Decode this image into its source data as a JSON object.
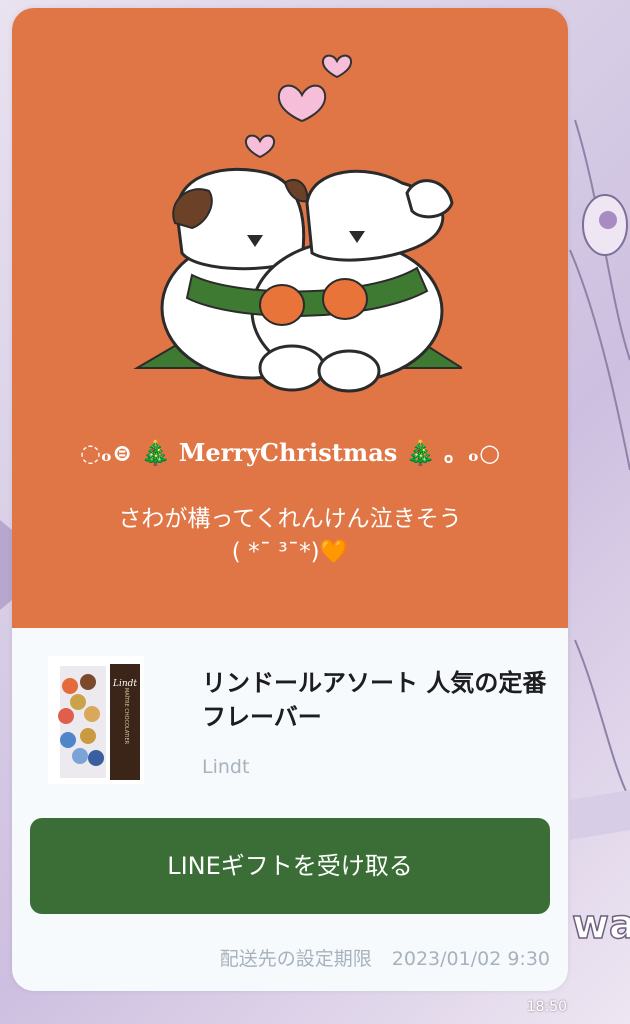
{
  "greeting": {
    "left_deco": "◌ₒ⊜",
    "left_tree": "🎄",
    "text": "MerryChristmas",
    "right_tree": "🎄",
    "right_deco": "。ₒ○"
  },
  "message": {
    "line1": "さわが構ってくれんけん泣きそう",
    "line2": "( *¯ ³¯*)",
    "heart": "🧡"
  },
  "product": {
    "title": "リンドールアソート 人気の定番フレーバー",
    "brand": "Lindt",
    "thumb_brand": "Lindt",
    "thumb_line": "MAÎTRE CHOCOLATIER"
  },
  "cta_label": "LINEギフトを受け取る",
  "deadline": {
    "label": "配送先の設定期限",
    "date": "2023/01/02 9:30"
  },
  "status_time": "18:50",
  "colors": {
    "card_top": "#e07546",
    "cta": "#3a6e36",
    "scarf": "#3f7a33",
    "heart": "#f5b8d6"
  }
}
